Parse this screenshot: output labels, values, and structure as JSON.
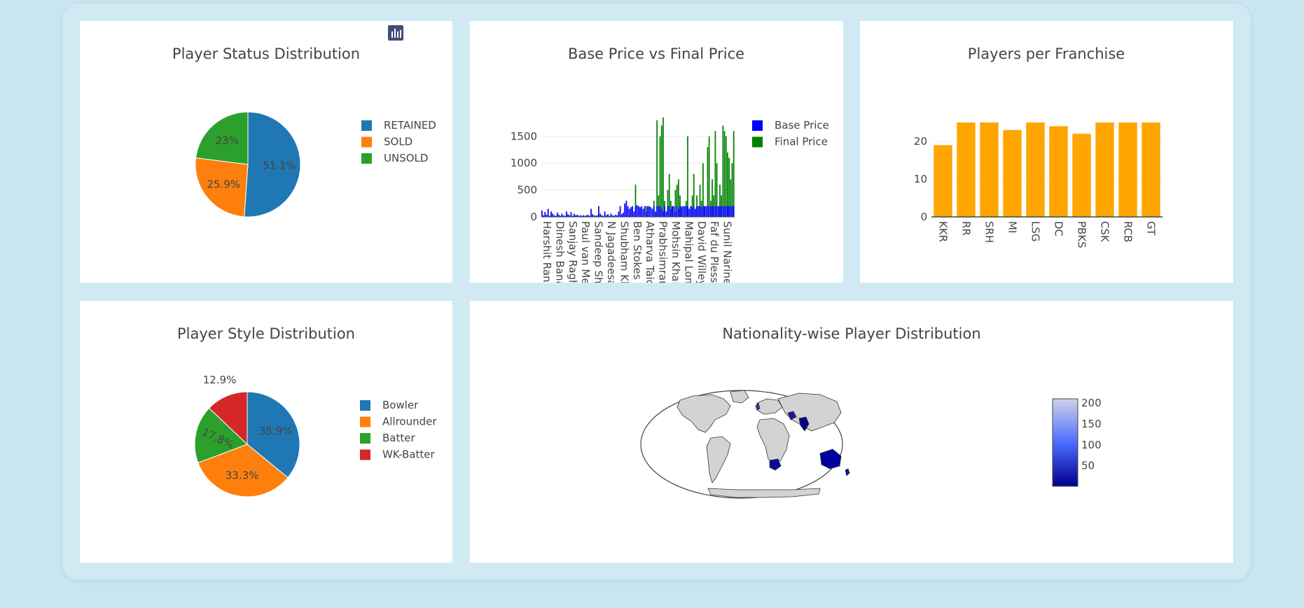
{
  "chart_data": [
    {
      "id": "status",
      "type": "pie",
      "title": "Player Status Distribution",
      "labels": [
        "RETAINED",
        "SOLD",
        "UNSOLD"
      ],
      "values": [
        51.1,
        25.9,
        23
      ],
      "slice_labels": [
        "51.1%",
        "25.9%",
        "23%"
      ],
      "colors": [
        "#1f77b4",
        "#ff7f0e",
        "#2ca02c"
      ],
      "label_color": [
        "#ffffff",
        "#444444",
        "#ffffff"
      ],
      "legend": "right"
    },
    {
      "id": "price",
      "type": "bar",
      "title": "Base Price vs Final Price",
      "series": [
        {
          "name": "Base Price",
          "color": "#0000ff"
        },
        {
          "name": "Final Price",
          "color": "#008000"
        }
      ],
      "yticks": [
        0,
        500,
        1000,
        1500
      ],
      "ylim": [
        0,
        1850
      ],
      "xticklabels": [
        "Harshit Rana",
        "Dinesh Bana",
        "Sanjay Ragh",
        "Paul van Me",
        "Sandeep Sh",
        "N Jagadeesa",
        "Shubham Kh",
        "Ben Stokes",
        "Atharva Taic",
        "Prabhsimran",
        "Mohsin Khar",
        "Mahipal Lom",
        "David Willey",
        "Faf du Plessi",
        "Sunil Narine"
      ],
      "base_values": [
        120,
        30,
        90,
        40,
        150,
        20,
        100,
        60,
        30,
        20,
        80,
        40,
        20,
        60,
        30,
        20,
        100,
        50,
        30,
        90,
        20,
        60,
        30,
        40,
        20,
        30,
        20,
        30,
        20,
        30,
        40,
        20,
        150,
        50,
        30,
        20,
        30,
        200,
        60,
        30,
        20,
        100,
        30,
        50,
        20,
        60,
        30,
        20,
        40,
        30,
        100,
        200,
        50,
        80,
        250,
        300,
        200,
        150,
        180,
        200,
        100,
        200,
        220,
        200,
        180,
        200,
        150,
        200,
        100,
        200,
        200,
        180,
        150,
        200,
        100,
        200,
        200,
        200,
        150,
        100,
        200,
        100,
        200,
        200,
        150,
        200,
        200,
        100,
        200,
        150,
        200,
        180,
        200,
        200,
        200,
        200,
        150,
        200,
        180,
        200,
        150,
        200,
        200,
        200,
        180,
        200,
        200,
        200,
        200,
        200,
        200,
        200,
        200,
        200,
        200,
        200,
        200,
        200,
        200,
        200,
        200,
        200,
        200,
        200,
        200,
        200
      ],
      "final_values": [
        0,
        0,
        0,
        0,
        0,
        0,
        0,
        0,
        0,
        0,
        0,
        0,
        0,
        0,
        0,
        0,
        0,
        0,
        0,
        0,
        0,
        0,
        0,
        0,
        0,
        0,
        0,
        0,
        0,
        0,
        0,
        0,
        0,
        0,
        0,
        0,
        0,
        0,
        0,
        0,
        0,
        0,
        0,
        0,
        0,
        0,
        0,
        0,
        0,
        0,
        0,
        0,
        0,
        0,
        0,
        150,
        0,
        0,
        0,
        0,
        0,
        600,
        0,
        0,
        0,
        0,
        0,
        0,
        200,
        0,
        0,
        0,
        0,
        300,
        0,
        1800,
        400,
        1500,
        1700,
        1850,
        300,
        0,
        500,
        800,
        300,
        200,
        0,
        500,
        600,
        700,
        400,
        200,
        0,
        0,
        300,
        1500,
        0,
        200,
        400,
        800,
        0,
        400,
        200,
        600,
        300,
        1000,
        200,
        0,
        1300,
        1500,
        300,
        700,
        400,
        1600,
        1000,
        200,
        600,
        400,
        1700,
        1600,
        1500,
        1200,
        1100,
        700,
        1000,
        1600
      ],
      "legend": "right"
    },
    {
      "id": "franchise",
      "type": "bar",
      "title": "Players per Franchise",
      "categories": [
        "KKR",
        "RR",
        "SRH",
        "MI",
        "LSG",
        "DC",
        "PBKS",
        "CSK",
        "RCB",
        "GT"
      ],
      "values": [
        19,
        25,
        25,
        23,
        25,
        24,
        22,
        25,
        25,
        25
      ],
      "yticks": [
        0,
        10,
        20
      ],
      "ylim": [
        0,
        26.3
      ],
      "color": "#ffa500"
    },
    {
      "id": "style",
      "type": "pie",
      "title": "Player Style Distribution",
      "labels": [
        "Bowler",
        "Allrounder",
        "Batter",
        "WK-Batter"
      ],
      "values": [
        35.9,
        33.3,
        17.8,
        12.9
      ],
      "slice_labels": [
        "35.9%",
        "33.3%",
        "17.8%",
        "12.9%"
      ],
      "colors": [
        "#1f77b4",
        "#ff7f0e",
        "#2ca02c",
        "#d62728"
      ],
      "label_color": [
        "#ffffff",
        "#444444",
        "#ffffff",
        "#444444"
      ],
      "legend": "right"
    },
    {
      "id": "map",
      "type": "heatmap",
      "title": "Nationality-wise Player Distribution",
      "colorbar_ticks": [
        50,
        100,
        150,
        200
      ],
      "colorbar_range": [
        1,
        210
      ],
      "colorscale": [
        "#00008b",
        "#4e6dff",
        "#cfd3e8"
      ]
    }
  ]
}
